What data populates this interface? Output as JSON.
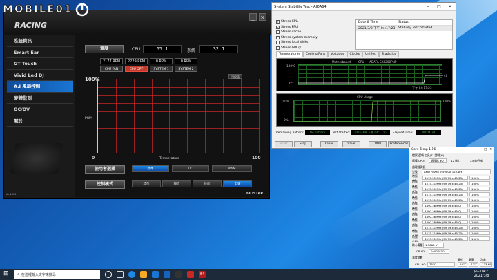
{
  "watermark": {
    "text": "MOBILE01"
  },
  "ai_app": {
    "brand": "RACING",
    "nav": [
      {
        "label": "系統資訊"
      },
      {
        "label": "Smart Ear"
      },
      {
        "label": "GT Touch"
      },
      {
        "label": "Vivid Led DJ"
      },
      {
        "label": "A.I 風扇控制"
      },
      {
        "label": "硬體監測"
      },
      {
        "label": "OC/OV"
      },
      {
        "label": "關於"
      }
    ],
    "temp_label": "溫度",
    "cpu_label": "CPU",
    "cpu_temp": "65.1",
    "sys_label": "系統",
    "sys_temp": "32.1",
    "rpms": [
      "2177 RPM",
      "2229 RPM",
      "0 RPM",
      "0 RPM"
    ],
    "fans": [
      "CPU FAN",
      "CPU OPT",
      "SYSTEM 1",
      "SYSTEM 2"
    ],
    "chart_label": "預設值",
    "y_top": "100%",
    "y_mid": "PWM",
    "x_zero": "0",
    "x_label": "Temperature",
    "x_max": "100",
    "user_select_label": "使用者選擇",
    "user_opts": [
      "標準",
      "DC",
      "PWM"
    ],
    "mode_label": "控制模式",
    "mode_opts": [
      "標準",
      "靜音",
      "效能",
      "全速"
    ],
    "footer_brand": "BIOSTAR",
    "version": "Ver.1.0.1"
  },
  "aida": {
    "title": "System Stability Test - AIDA64",
    "checks": [
      {
        "label": "Stress CPU",
        "checked": true
      },
      {
        "label": "Stress FPU",
        "checked": true
      },
      {
        "label": "Stress cache",
        "checked": false
      },
      {
        "label": "Stress system memory",
        "checked": false
      },
      {
        "label": "Stress local disks",
        "checked": false
      },
      {
        "label": "Stress GPU(s)",
        "checked": false
      }
    ],
    "table_headers": [
      "Date & Time",
      "Status"
    ],
    "table_row": [
      "2021/3/8 下午 04:17:23",
      "Stability Test: Started"
    ],
    "tabs": [
      "Temperatures",
      "Cooling Fans",
      "Voltages",
      "Clocks",
      "Unified",
      "Statistics"
    ],
    "legend": [
      "Motherboard",
      "CPU",
      "ADATA SX8200PNP"
    ],
    "g1_top": "100°C",
    "g1_bot": "0°C",
    "g1_time": "下午 04:17:23",
    "g1_val": "40",
    "g2_title": "CPU Usage",
    "g2_top": "100%",
    "g2_bot": "0%",
    "g2_val": "100%",
    "battery_label": "Remaining Battery:",
    "battery_val": "No battery",
    "started_label": "Test Started:",
    "started_val": "2021/3/8 下午 04:17:23",
    "elapsed_label": "Elapsed Time:",
    "elapsed_val": "00:04:24",
    "buttons": [
      "Start",
      "Stop",
      "Clear",
      "Save",
      "CPUID",
      "Preferences"
    ]
  },
  "coretemp": {
    "title": "Core Temp 1.16",
    "menu": "檔案  選項  工具(T)  說明(H)",
    "select_label": "選擇 CPU:",
    "cpu_sel": "處理器 #0",
    "cores": "12 核心",
    "threads": "24 執行緒",
    "info_label": "處理器資訊",
    "model_label": "型號:",
    "model": "AMD Ryzen 9 5900X 12-Core",
    "cores_rows": [
      [
        "時脈 #0:",
        "4515.31MHz (99.79 x 45.25)",
        "100%"
      ],
      [
        "時脈 #1:",
        "4515.31MHz (99.79 x 45.25)",
        "100%"
      ],
      [
        "時脈 #2:",
        "4515.31MHz (99.79 x 45.25)",
        "100%"
      ],
      [
        "時脈 #3:",
        "4515.31MHz (99.79 x 45.25)",
        "100%"
      ],
      [
        "時脈 #4:",
        "4515.31MHz (99.79 x 45.25)",
        "100%"
      ],
      [
        "時脈 #5:",
        "4490.36MHz (99.79 x 45.0)",
        "100%"
      ],
      [
        "時脈 #6:",
        "4490.36MHz (99.79 x 45.0)",
        "100%"
      ],
      [
        "時脈 #7:",
        "4490.36MHz (99.79 x 45.0)",
        "100%"
      ],
      [
        "時脈 #8:",
        "4490.36MHz (99.79 x 45.0)",
        "100%"
      ],
      [
        "時脈 #9:",
        "4515.31MHz (99.79 x 45.25)",
        "100%"
      ],
      [
        "時脈 #10:",
        "4515.31MHz (99.79 x 45.25)",
        "100%"
      ],
      [
        "時脈 #11:",
        "4515.31MHz (99.79 x 45.25)",
        "100%"
      ]
    ],
    "vid_label": "核心電壓:",
    "vid": "1.3000 V",
    "cpuid_label": "CPUID:",
    "cpuid": "0xA20F10",
    "tj_label": "溫度讀數",
    "tj_headers": [
      "最低",
      "最高",
      "功耗:"
    ],
    "cpu0_label": "CPU #0:",
    "cpu0_temp": "75°C",
    "cpu0_min": "28°C",
    "cpu0_max": "77°C",
    "cpu0_power": "133.69"
  },
  "taskbar": {
    "search_placeholder": "在這裡輸入文字來搜尋",
    "time": "下午 04:21",
    "date": "2021/3/8",
    "ime": "英",
    "badge": "64"
  }
}
